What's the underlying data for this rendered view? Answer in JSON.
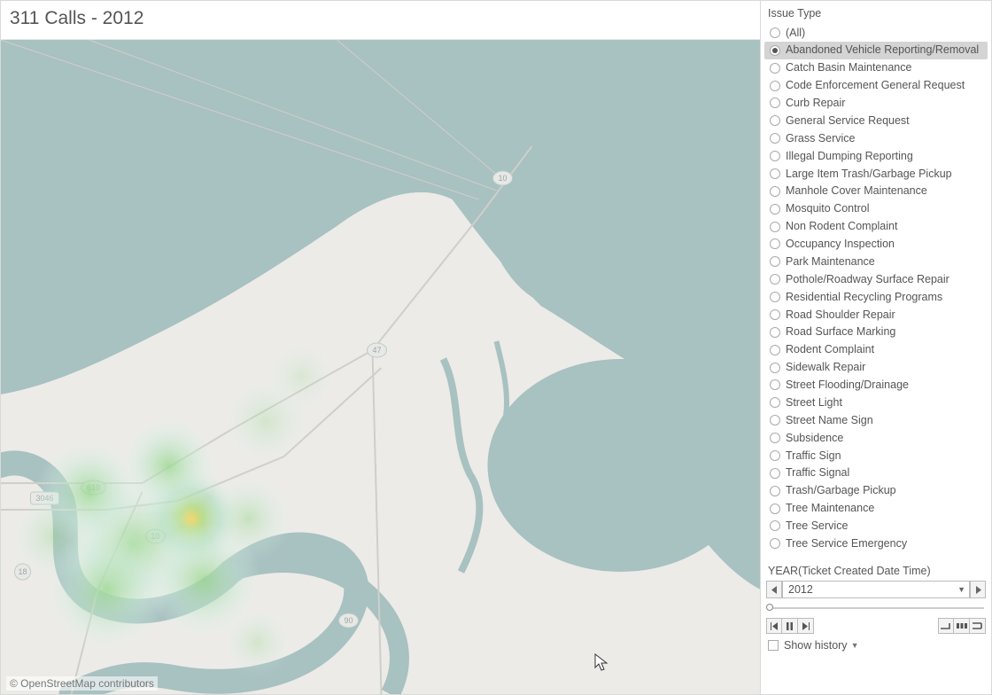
{
  "title": "311 Calls - 2012",
  "attribution": "© OpenStreetMap contributors",
  "filters": {
    "issue_type": {
      "label": "Issue Type",
      "selected": "Abandoned Vehicle Reporting/Removal",
      "options": [
        "(All)",
        "Abandoned Vehicle Reporting/Removal",
        "Catch Basin Maintenance",
        "Code Enforcement General Request",
        "Curb Repair",
        "General Service Request",
        "Grass Service",
        "Illegal Dumping Reporting",
        "Large Item Trash/Garbage Pickup",
        "Manhole Cover Maintenance",
        "Mosquito Control",
        "Non Rodent Complaint",
        "Occupancy Inspection",
        "Park Maintenance",
        "Pothole/Roadway Surface Repair",
        "Residential Recycling Programs",
        "Road Shoulder Repair",
        "Road Surface Marking",
        "Rodent Complaint",
        "Sidewalk Repair",
        "Street Flooding/Drainage",
        "Street Light",
        "Street Name Sign",
        "Subsidence",
        "Traffic Sign",
        "Traffic Signal",
        "Trash/Garbage Pickup",
        "Tree Maintenance",
        "Tree Service",
        "Tree Service Emergency"
      ]
    },
    "year": {
      "label": "YEAR(Ticket Created Date Time)",
      "value": "2012",
      "show_history_label": "Show history"
    }
  },
  "map": {
    "shields": [
      "10",
      "10",
      "47",
      "610",
      "3046",
      "18",
      "10",
      "90"
    ],
    "heatmap_center": "urban core"
  }
}
